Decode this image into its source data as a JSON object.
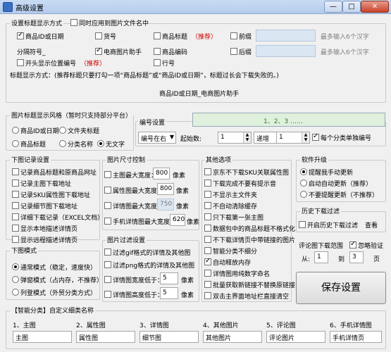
{
  "window": {
    "title": "高级设置",
    "min": "—",
    "max": "□",
    "close": "✕"
  },
  "title_settings": {
    "group": "设置标题显示方式",
    "sync": "同时应用到图片文件名中",
    "cb": [
      "商品ID或日期",
      "货号",
      "商品标题",
      "前缀",
      "分隔符号_",
      "电商图片助手",
      "商品编码",
      "后缀",
      "开头显示位置编号",
      "行号"
    ],
    "recommend": "（推荐）",
    "hint": "最多输入6个汉字",
    "desc": "标题显示方式：(推荐标题只要打勾一项“商品标题”或“商品ID或日期”，标题过长会下载失败的。)",
    "preview": "商品ID或日期_电商图片助手"
  },
  "style": {
    "group": "图片标题显示风格（暂时只支持部分平台）",
    "radios": [
      "商品ID或日期",
      "文件夹标题",
      "商品标题",
      "分类名称",
      "无文字"
    ]
  },
  "numbering": {
    "group": "编号设置",
    "sample": "1、2、3 ……",
    "pos": "编号在右",
    "start_label": "起始数:",
    "start": "1",
    "mode": "递增",
    "step": "1",
    "per_cat": "每个分类单独编号"
  },
  "records": {
    "group": "下图记录设置",
    "items": [
      "记录商品标题和原商品网址",
      "记录主图下载地址",
      "记录SKU属性图下载地址",
      "记录细节图下载地址",
      "详细下载记录（EXCEL文档）",
      "显示本地描述详情页",
      "显示远程描述详情页"
    ]
  },
  "mode": {
    "group": "下图模式",
    "items": [
      "通常模式（稳定，速度快）",
      "弹窗模式（占内存，不推荐）",
      "列登模式（外贸分类方式）"
    ]
  },
  "size": {
    "group": "图片尺寸控制",
    "unit": "像素",
    "rows": [
      {
        "label": "主图最大宽度：",
        "value": "800"
      },
      {
        "label": "属性图最大宽度：",
        "value": "800"
      },
      {
        "label": "详情图最大宽度：",
        "value": "750"
      },
      {
        "label": "手机详情图最大宽度：",
        "value": "620"
      }
    ]
  },
  "filter": {
    "group": "图片过滤设置",
    "gif": "过滤gif格式的详情及其他图",
    "png": "过滤png格式的详情及其他图",
    "w_label": "详情图宽度低于：",
    "w": "5",
    "h_label": "详情图高度低于：",
    "h": "5",
    "unit": "像素"
  },
  "other": {
    "group": "其他选项",
    "items": [
      "京东不下载SKU关联属性图",
      "下载完成不要有提示音",
      "不显示主文件夹",
      "不自动清除缓存",
      "只下载第一张主图",
      "数据包中的商品标题不格式化",
      "不下载详情页中带链接的图片",
      "智能分类不细分",
      "自动释放内存",
      "详情图用纯数字命名",
      "批量获取新链接不替换原链接",
      "双击主界面地址栏直接清空"
    ]
  },
  "upgrade": {
    "group": "软件升级",
    "items": [
      "提醒我手动更新",
      "启动自动更新（推荐）",
      "不要提醒更新（不推荐）"
    ]
  },
  "history": {
    "group": "历史下载过滤",
    "toggle": "开启历史下载过滤",
    "view": "查看"
  },
  "review": {
    "group": "评论图下载范围",
    "ignore": "忽略验证",
    "from": "从:",
    "from_v": "1",
    "to": "到",
    "to_v": "3",
    "page": "页"
  },
  "save": "保存设置",
  "smart": {
    "group": "【智能分类】自定义细类名称",
    "items": [
      {
        "label": "1、主图",
        "value": "主图"
      },
      {
        "label": "2、属性图",
        "value": "属性图"
      },
      {
        "label": "3、详情图",
        "value": "细节图"
      },
      {
        "label": "4、其他图片",
        "value": "其他图片"
      },
      {
        "label": "5、评论图",
        "value": "评论图片"
      },
      {
        "label": "6、手机详情图",
        "value": "手机详情页"
      }
    ]
  }
}
